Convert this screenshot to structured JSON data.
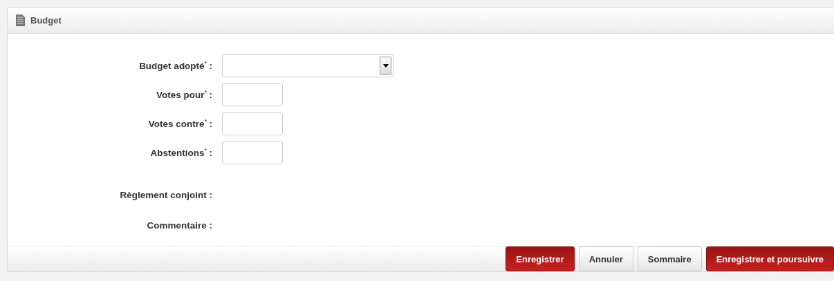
{
  "panel": {
    "title": "Budget"
  },
  "fields": [
    {
      "label": "Budget adopté$^{*}$ :",
      "kind": "select"
    },
    {
      "label": "Votes pour$^{*}$ :",
      "kind": "number"
    },
    {
      "label": "Votes contre$^{*}$ :",
      "kind": "number"
    },
    {
      "label": "Abstentions$^{*}$ :",
      "kind": "number"
    },
    {
      "label": "Règlement conjoint :",
      "kind": "static"
    },
    {
      "label": "Commentaire :",
      "kind": "static"
    }
  ],
  "buttons": [
    {
      "label": "Enregistrer",
      "kind": "primary"
    },
    {
      "label": "Annuler",
      "kind": "secondary"
    },
    {
      "label": "Sommaire",
      "kind": "secondary"
    },
    {
      "label": "Enregistrer et poursuivre",
      "kind": "primary"
    }
  ]
}
